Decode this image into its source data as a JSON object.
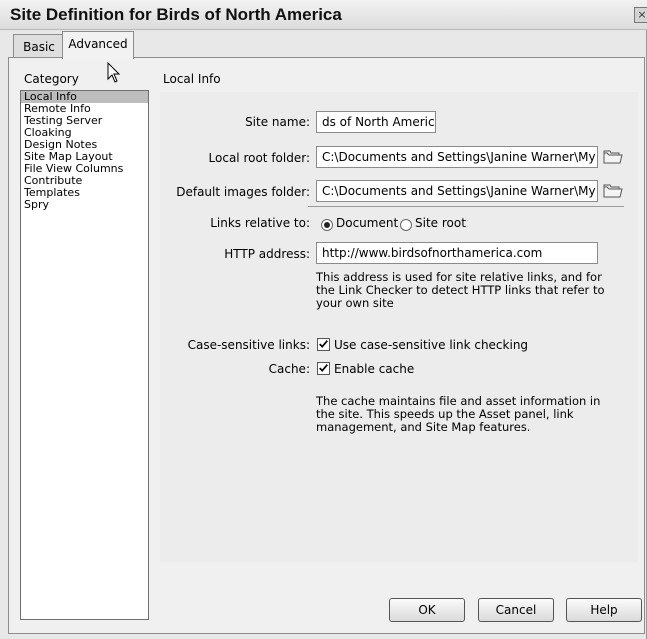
{
  "window": {
    "title": "Site Definition for Birds of North America",
    "close_glyph": "×"
  },
  "tabs": [
    {
      "label": "Basic",
      "selected": false
    },
    {
      "label": "Advanced",
      "selected": true
    }
  ],
  "sidebar": {
    "heading": "Category",
    "items": [
      {
        "label": "Local Info",
        "selected": true
      },
      {
        "label": "Remote Info"
      },
      {
        "label": "Testing Server"
      },
      {
        "label": "Cloaking"
      },
      {
        "label": "Design Notes"
      },
      {
        "label": "Site Map Layout"
      },
      {
        "label": "File View Columns"
      },
      {
        "label": "Contribute"
      },
      {
        "label": "Templates"
      },
      {
        "label": "Spry"
      }
    ]
  },
  "main": {
    "section_title": "Local Info",
    "site_name": {
      "label": "Site name:",
      "value": "ds of North America"
    },
    "local_root": {
      "label": "Local root folder:",
      "value": "C:\\Documents and Settings\\Janine Warner\\My Do"
    },
    "default_images": {
      "label": "Default images folder:",
      "value": "C:\\Documents and Settings\\Janine Warner\\My Do"
    },
    "links_relative": {
      "label": "Links relative to:",
      "options": [
        {
          "label": "Document",
          "checked": true
        },
        {
          "label": "Site root",
          "checked": false
        }
      ]
    },
    "http_address": {
      "label": "HTTP address:",
      "value": "http://www.birdsofnorthamerica.com",
      "help_lines": [
        "This address is used for site relative links, and for",
        "the Link Checker to detect HTTP links that refer to",
        "your own site"
      ]
    },
    "case_sensitive": {
      "label": "Case-sensitive links:",
      "checkbox_label": "Use case-sensitive link checking",
      "checked": true
    },
    "cache": {
      "label": "Cache:",
      "checkbox_label": "Enable cache",
      "checked": true,
      "help_lines": [
        "The cache maintains file and asset information in",
        "the site.  This speeds up the Asset panel, link",
        "management, and Site Map features."
      ]
    }
  },
  "buttons": {
    "ok": "OK",
    "cancel": "Cancel",
    "help": "Help"
  }
}
